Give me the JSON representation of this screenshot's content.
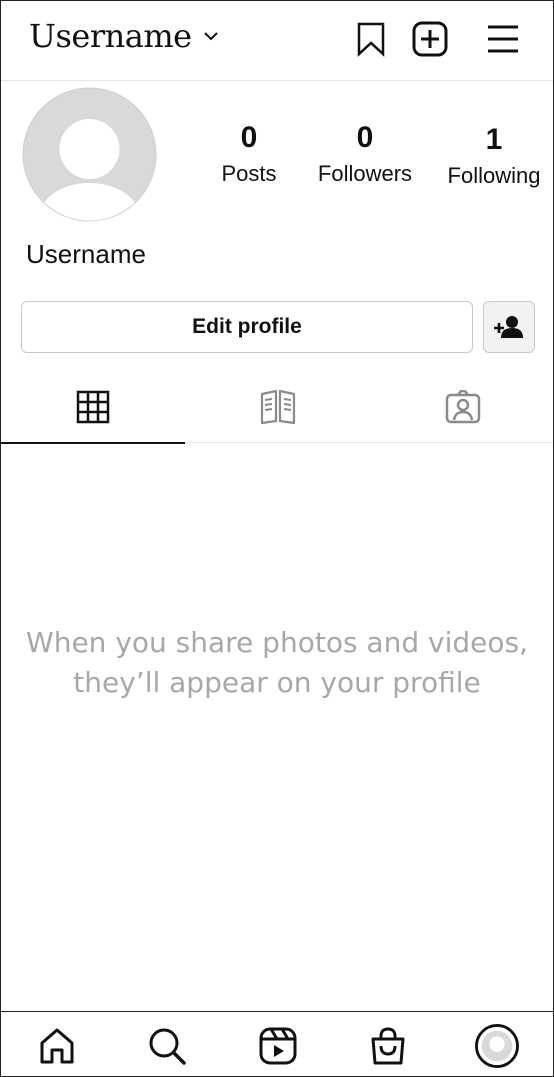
{
  "header": {
    "username": "Username",
    "icons": [
      "bookmark-icon",
      "add-post-icon",
      "menu-icon"
    ]
  },
  "profile": {
    "avatar": "default-avatar",
    "stats": [
      {
        "value": "0",
        "label": "Posts"
      },
      {
        "value": "0",
        "label": "Followers"
      },
      {
        "value": "1",
        "label": "Following"
      }
    ],
    "display_name": "Username",
    "edit_button": "Edit profile",
    "discover_icon": "add-person-icon"
  },
  "tabs": [
    {
      "name": "grid",
      "icon": "grid-icon",
      "active": true
    },
    {
      "name": "guides",
      "icon": "book-icon",
      "active": false
    },
    {
      "name": "tagged",
      "icon": "tagged-person-icon",
      "active": false
    }
  ],
  "empty_state": {
    "line1": "When you share photos and videos,",
    "line2": "they’ll appear on your profile"
  },
  "bottom_nav": {
    "items": [
      "home-icon",
      "search-icon",
      "reels-icon",
      "shop-icon",
      "profile-avatar"
    ]
  },
  "colors": {
    "text": "#111111",
    "muted": "#a8a8a8",
    "border": "#c9c9c9",
    "avatar_bg": "#d9d9d9"
  }
}
